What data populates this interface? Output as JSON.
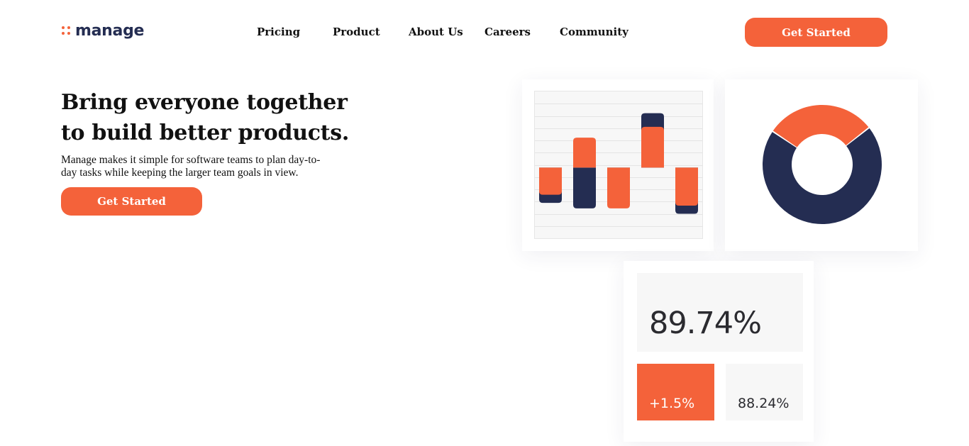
{
  "brand": {
    "name": "manage",
    "accent": "#f4623a",
    "navy": "#242d52"
  },
  "nav": {
    "items": [
      {
        "label": "Pricing"
      },
      {
        "label": "Product"
      },
      {
        "label": "About Us"
      },
      {
        "label": "Careers"
      },
      {
        "label": "Community"
      }
    ],
    "cta_label": "Get Started"
  },
  "hero": {
    "title_line1": "Bring everyone together",
    "title_line2": "to build better products.",
    "description": "Manage makes it simple for software teams to plan day-to-day tasks while keeping the larger team goals in view.",
    "cta_label": "Get Started"
  },
  "chart_data": [
    {
      "type": "bar",
      "categories": [
        "",
        "",
        "",
        "",
        ""
      ],
      "series": [
        {
          "values": [
            -1.3,
            -1.5,
            -1.0,
            2.0,
            -1.7
          ]
        },
        {
          "values": [
            -1.0,
            1.1,
            -1.5,
            1.5,
            -1.4
          ]
        }
      ],
      "ylim": [
        -2.6,
        2.8
      ],
      "grid": true,
      "colors": [
        "#242d52",
        "#f4623a"
      ]
    },
    {
      "type": "pie",
      "labels": [
        "",
        ""
      ],
      "values": [
        30,
        70
      ],
      "colors": [
        "#f4623a",
        "#242d52"
      ],
      "donut": true
    }
  ],
  "stats": {
    "main_value": "89.74%",
    "change_value": "+1.5%",
    "secondary_value": "88.24%"
  }
}
